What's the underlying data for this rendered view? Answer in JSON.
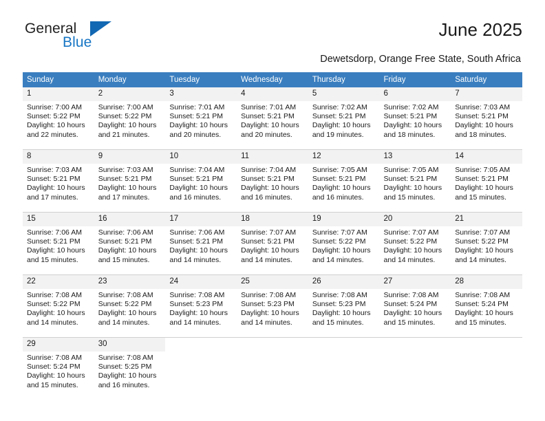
{
  "brand": {
    "word1": "General",
    "word2": "Blue",
    "triangle_color": "#1268b3",
    "blue_color": "#1675c4"
  },
  "header": {
    "title": "June 2025",
    "subtitle": "Dewetsdorp, Orange Free State, South Africa"
  },
  "theme": {
    "header_row_bg": "#3a7ebf",
    "daynum_bg": "#f2f2f2",
    "grid_line": "#d0d0d0"
  },
  "calendar": {
    "weekday_headers": [
      "Sunday",
      "Monday",
      "Tuesday",
      "Wednesday",
      "Thursday",
      "Friday",
      "Saturday"
    ],
    "weeks": [
      [
        {
          "day": "1",
          "sunrise": "Sunrise: 7:00 AM",
          "sunset": "Sunset: 5:22 PM",
          "daylight_line1": "Daylight: 10 hours",
          "daylight_line2": "and 22 minutes."
        },
        {
          "day": "2",
          "sunrise": "Sunrise: 7:00 AM",
          "sunset": "Sunset: 5:22 PM",
          "daylight_line1": "Daylight: 10 hours",
          "daylight_line2": "and 21 minutes."
        },
        {
          "day": "3",
          "sunrise": "Sunrise: 7:01 AM",
          "sunset": "Sunset: 5:21 PM",
          "daylight_line1": "Daylight: 10 hours",
          "daylight_line2": "and 20 minutes."
        },
        {
          "day": "4",
          "sunrise": "Sunrise: 7:01 AM",
          "sunset": "Sunset: 5:21 PM",
          "daylight_line1": "Daylight: 10 hours",
          "daylight_line2": "and 20 minutes."
        },
        {
          "day": "5",
          "sunrise": "Sunrise: 7:02 AM",
          "sunset": "Sunset: 5:21 PM",
          "daylight_line1": "Daylight: 10 hours",
          "daylight_line2": "and 19 minutes."
        },
        {
          "day": "6",
          "sunrise": "Sunrise: 7:02 AM",
          "sunset": "Sunset: 5:21 PM",
          "daylight_line1": "Daylight: 10 hours",
          "daylight_line2": "and 18 minutes."
        },
        {
          "day": "7",
          "sunrise": "Sunrise: 7:03 AM",
          "sunset": "Sunset: 5:21 PM",
          "daylight_line1": "Daylight: 10 hours",
          "daylight_line2": "and 18 minutes."
        }
      ],
      [
        {
          "day": "8",
          "sunrise": "Sunrise: 7:03 AM",
          "sunset": "Sunset: 5:21 PM",
          "daylight_line1": "Daylight: 10 hours",
          "daylight_line2": "and 17 minutes."
        },
        {
          "day": "9",
          "sunrise": "Sunrise: 7:03 AM",
          "sunset": "Sunset: 5:21 PM",
          "daylight_line1": "Daylight: 10 hours",
          "daylight_line2": "and 17 minutes."
        },
        {
          "day": "10",
          "sunrise": "Sunrise: 7:04 AM",
          "sunset": "Sunset: 5:21 PM",
          "daylight_line1": "Daylight: 10 hours",
          "daylight_line2": "and 16 minutes."
        },
        {
          "day": "11",
          "sunrise": "Sunrise: 7:04 AM",
          "sunset": "Sunset: 5:21 PM",
          "daylight_line1": "Daylight: 10 hours",
          "daylight_line2": "and 16 minutes."
        },
        {
          "day": "12",
          "sunrise": "Sunrise: 7:05 AM",
          "sunset": "Sunset: 5:21 PM",
          "daylight_line1": "Daylight: 10 hours",
          "daylight_line2": "and 16 minutes."
        },
        {
          "day": "13",
          "sunrise": "Sunrise: 7:05 AM",
          "sunset": "Sunset: 5:21 PM",
          "daylight_line1": "Daylight: 10 hours",
          "daylight_line2": "and 15 minutes."
        },
        {
          "day": "14",
          "sunrise": "Sunrise: 7:05 AM",
          "sunset": "Sunset: 5:21 PM",
          "daylight_line1": "Daylight: 10 hours",
          "daylight_line2": "and 15 minutes."
        }
      ],
      [
        {
          "day": "15",
          "sunrise": "Sunrise: 7:06 AM",
          "sunset": "Sunset: 5:21 PM",
          "daylight_line1": "Daylight: 10 hours",
          "daylight_line2": "and 15 minutes."
        },
        {
          "day": "16",
          "sunrise": "Sunrise: 7:06 AM",
          "sunset": "Sunset: 5:21 PM",
          "daylight_line1": "Daylight: 10 hours",
          "daylight_line2": "and 15 minutes."
        },
        {
          "day": "17",
          "sunrise": "Sunrise: 7:06 AM",
          "sunset": "Sunset: 5:21 PM",
          "daylight_line1": "Daylight: 10 hours",
          "daylight_line2": "and 14 minutes."
        },
        {
          "day": "18",
          "sunrise": "Sunrise: 7:07 AM",
          "sunset": "Sunset: 5:21 PM",
          "daylight_line1": "Daylight: 10 hours",
          "daylight_line2": "and 14 minutes."
        },
        {
          "day": "19",
          "sunrise": "Sunrise: 7:07 AM",
          "sunset": "Sunset: 5:22 PM",
          "daylight_line1": "Daylight: 10 hours",
          "daylight_line2": "and 14 minutes."
        },
        {
          "day": "20",
          "sunrise": "Sunrise: 7:07 AM",
          "sunset": "Sunset: 5:22 PM",
          "daylight_line1": "Daylight: 10 hours",
          "daylight_line2": "and 14 minutes."
        },
        {
          "day": "21",
          "sunrise": "Sunrise: 7:07 AM",
          "sunset": "Sunset: 5:22 PM",
          "daylight_line1": "Daylight: 10 hours",
          "daylight_line2": "and 14 minutes."
        }
      ],
      [
        {
          "day": "22",
          "sunrise": "Sunrise: 7:08 AM",
          "sunset": "Sunset: 5:22 PM",
          "daylight_line1": "Daylight: 10 hours",
          "daylight_line2": "and 14 minutes."
        },
        {
          "day": "23",
          "sunrise": "Sunrise: 7:08 AM",
          "sunset": "Sunset: 5:22 PM",
          "daylight_line1": "Daylight: 10 hours",
          "daylight_line2": "and 14 minutes."
        },
        {
          "day": "24",
          "sunrise": "Sunrise: 7:08 AM",
          "sunset": "Sunset: 5:23 PM",
          "daylight_line1": "Daylight: 10 hours",
          "daylight_line2": "and 14 minutes."
        },
        {
          "day": "25",
          "sunrise": "Sunrise: 7:08 AM",
          "sunset": "Sunset: 5:23 PM",
          "daylight_line1": "Daylight: 10 hours",
          "daylight_line2": "and 14 minutes."
        },
        {
          "day": "26",
          "sunrise": "Sunrise: 7:08 AM",
          "sunset": "Sunset: 5:23 PM",
          "daylight_line1": "Daylight: 10 hours",
          "daylight_line2": "and 15 minutes."
        },
        {
          "day": "27",
          "sunrise": "Sunrise: 7:08 AM",
          "sunset": "Sunset: 5:24 PM",
          "daylight_line1": "Daylight: 10 hours",
          "daylight_line2": "and 15 minutes."
        },
        {
          "day": "28",
          "sunrise": "Sunrise: 7:08 AM",
          "sunset": "Sunset: 5:24 PM",
          "daylight_line1": "Daylight: 10 hours",
          "daylight_line2": "and 15 minutes."
        }
      ],
      [
        {
          "day": "29",
          "sunrise": "Sunrise: 7:08 AM",
          "sunset": "Sunset: 5:24 PM",
          "daylight_line1": "Daylight: 10 hours",
          "daylight_line2": "and 15 minutes."
        },
        {
          "day": "30",
          "sunrise": "Sunrise: 7:08 AM",
          "sunset": "Sunset: 5:25 PM",
          "daylight_line1": "Daylight: 10 hours",
          "daylight_line2": "and 16 minutes."
        },
        {
          "day": "",
          "sunrise": "",
          "sunset": "",
          "daylight_line1": "",
          "daylight_line2": ""
        },
        {
          "day": "",
          "sunrise": "",
          "sunset": "",
          "daylight_line1": "",
          "daylight_line2": ""
        },
        {
          "day": "",
          "sunrise": "",
          "sunset": "",
          "daylight_line1": "",
          "daylight_line2": ""
        },
        {
          "day": "",
          "sunrise": "",
          "sunset": "",
          "daylight_line1": "",
          "daylight_line2": ""
        },
        {
          "day": "",
          "sunrise": "",
          "sunset": "",
          "daylight_line1": "",
          "daylight_line2": ""
        }
      ]
    ]
  }
}
